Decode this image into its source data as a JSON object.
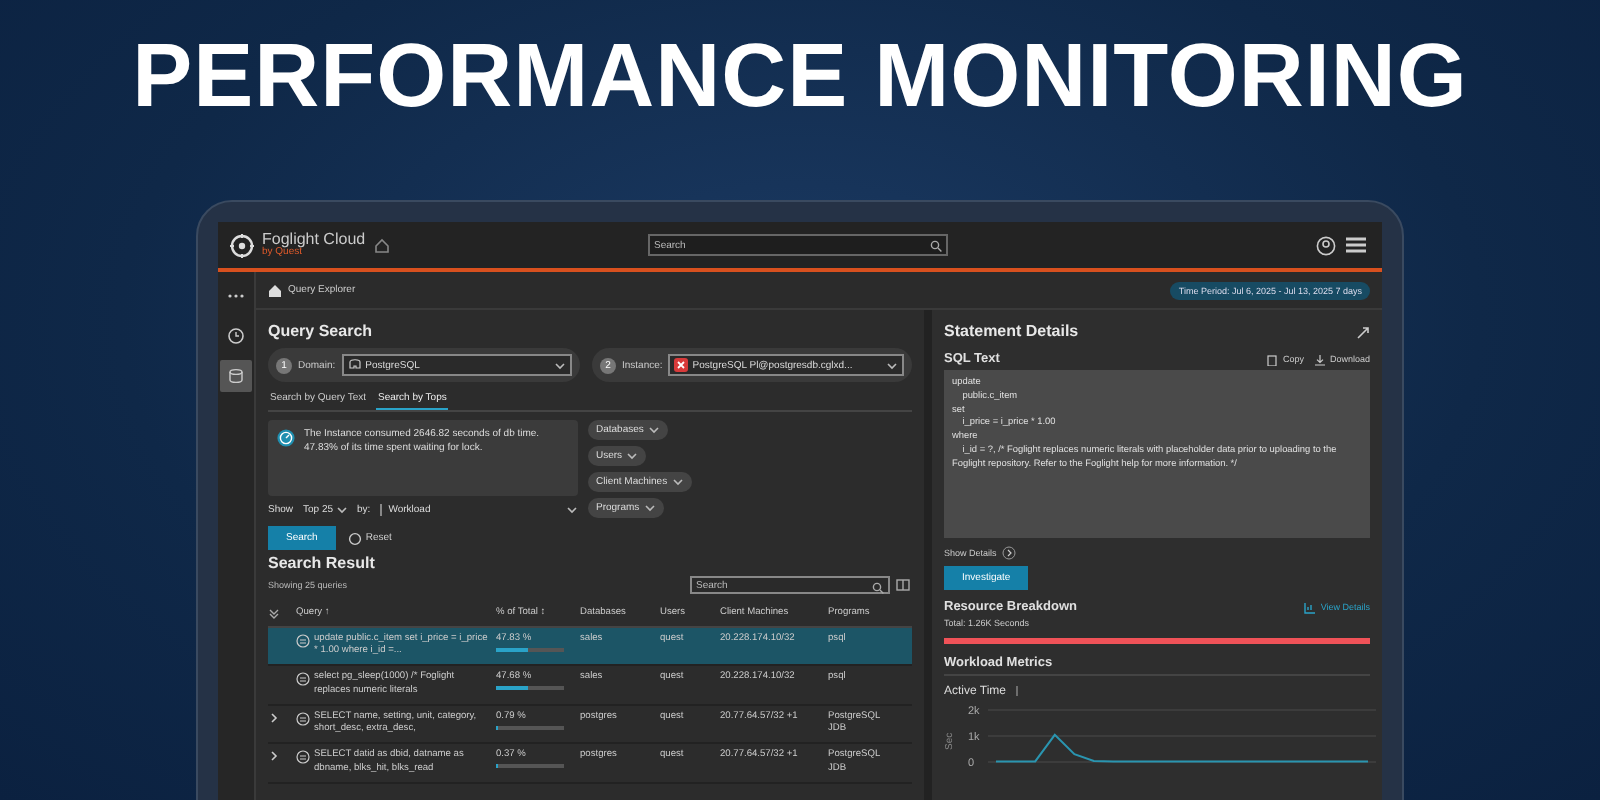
{
  "headline": "PERFORMANCE MONITORING",
  "app": {
    "brand": "Foglight Cloud",
    "brand_sub": "by Quest",
    "search": {
      "placeholder": "Search"
    },
    "breadcrumb": "Query Explorer",
    "time_period": "Time Period: Jul 6, 2025 - Jul 13, 2025 7 days",
    "sidebar": [
      {
        "kind": "more",
        "selected": false
      },
      {
        "kind": "clock",
        "selected": false
      },
      {
        "kind": "database",
        "selected": true
      }
    ]
  },
  "query_search": {
    "title": "Query Search",
    "steps": [
      {
        "number": "1",
        "label": "Domain:",
        "value": "PostgreSQL",
        "kind": "database"
      },
      {
        "number": "2",
        "label": "Instance:",
        "value": "PostgreSQL Pl@postgresdb.cglxd...",
        "kind": "error"
      }
    ],
    "tabs": [
      {
        "label": "Search by Query Text",
        "selected": false
      },
      {
        "label": "Search by Tops",
        "selected": true
      }
    ],
    "info": "The Instance consumed 2646.82 seconds of db time. 47.83% of its time spent waiting for lock.",
    "filters": [
      "Databases",
      "Users",
      "Client Machines",
      "Programs"
    ],
    "show_label": "Show",
    "top": "Top 25",
    "by_label": "by:",
    "by_value": "Workload",
    "search_button": "Search",
    "reset_button": "Reset"
  },
  "search_result": {
    "title": "Search Result",
    "subtitle": "Showing 25 queries",
    "search": {
      "placeholder": "Search"
    },
    "columns": [
      "Query ↑",
      "% of Total ↕",
      "Databases",
      "Users",
      "Client Machines",
      "Programs"
    ],
    "rows": [
      {
        "expandable": false,
        "selected": true,
        "query": "update public.c_item set i_price = i_price * 1.00 where i_id =...",
        "percent": "47.83 %",
        "level": 0.48,
        "database": "sales",
        "user": "quest",
        "client": "20.228.174.10/32",
        "program": "psql"
      },
      {
        "expandable": false,
        "selected": false,
        "query": "select pg_sleep(1000) /* Foglight replaces numeric literals",
        "percent": "47.68 %",
        "level": 0.47,
        "database": "sales",
        "user": "quest",
        "client": "20.228.174.10/32",
        "program": "psql"
      },
      {
        "expandable": true,
        "selected": false,
        "query": "SELECT name, setting, unit, category, short_desc, extra_desc,",
        "percent": "0.79 %",
        "level": 0.01,
        "database": "postgres",
        "user": "quest",
        "client": "20.77.64.57/32 +1",
        "program": "PostgreSQL JDB"
      },
      {
        "expandable": true,
        "selected": false,
        "query": "SELECT datid as dbid, datname as dbname, blks_hit, blks_read",
        "percent": "0.37 %",
        "level": 0.004,
        "database": "postgres",
        "user": "quest",
        "client": "20.77.64.57/32 +1",
        "program": "PostgreSQL JDB"
      }
    ]
  },
  "statement": {
    "title": "Statement Details",
    "sql_title": "SQL Text",
    "copy": "Copy",
    "download": "Download",
    "sql": "update\n    public.c_item\nset\n    i_price = i_price * 1.00\nwhere\n    i_id = ?, /* Foglight replaces numeric literals with placeholder data prior to uploading to the Foglight repository. Refer to the Foglight help for more information. */",
    "show_details": "Show Details",
    "investigate": "Investigate",
    "resource_title": "Resource Breakdown",
    "view_details": "View Details",
    "total": "Total: 1.26K Seconds",
    "workload_title": "Workload Metrics",
    "chart_data": {
      "type": "line",
      "title": "Active Time",
      "ylabel": "Sec",
      "ylim": [
        0,
        2000
      ],
      "yticks": [
        {
          "value": 0,
          "label": "0"
        },
        {
          "value": 1000,
          "label": "1k"
        },
        {
          "value": 2000,
          "label": "2k"
        }
      ],
      "series": [
        {
          "color": "#2a95b0",
          "values": [
            20,
            20,
            20,
            1050,
            300,
            40,
            20,
            20,
            20,
            20,
            20,
            20,
            20,
            20,
            20,
            20,
            20,
            20,
            20,
            20
          ]
        }
      ]
    }
  }
}
